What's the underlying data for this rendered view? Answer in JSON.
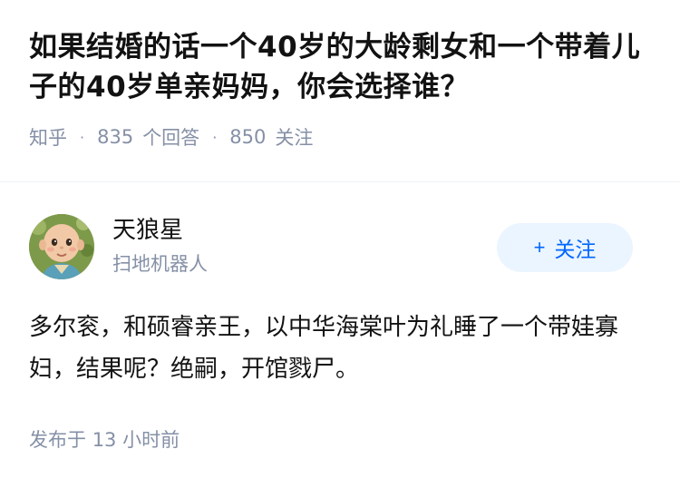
{
  "question": {
    "title": "如果结婚的话一个40岁的大龄剩女和一个带着儿子的40岁单亲妈妈，你会选择谁？",
    "source": "知乎",
    "answer_count": "835",
    "answer_label": "个回答",
    "follower_count": "850",
    "follower_label": "关注"
  },
  "author": {
    "name": "天狼星",
    "bio": "扫地机器人",
    "follow_icon": "+",
    "follow_label": "关注"
  },
  "answer": {
    "content": "多尔衮，和硕睿亲王，以中华海棠叶为礼睡了一个带娃寡妇，结果呢？绝嗣，开馆戮尸。",
    "time_prefix": "发布于",
    "time_value": "13",
    "time_unit": "小时前"
  },
  "colors": {
    "primary": "#0066ff",
    "follow_bg": "#ebf5ff",
    "text": "#121212",
    "meta": "#8590a6",
    "divider": "#f0f2f7"
  }
}
